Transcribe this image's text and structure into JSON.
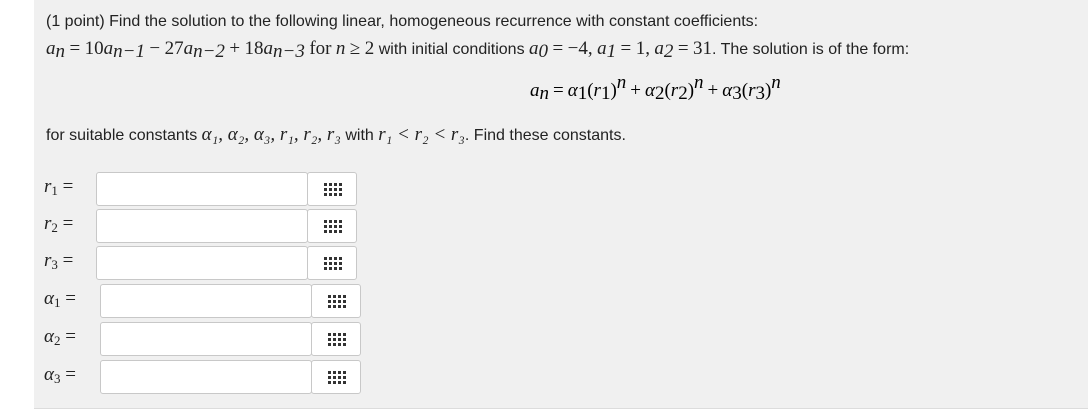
{
  "problem": {
    "intro": "(1 point) Find the solution to the following linear, homogeneous recurrence with constant coefficients:",
    "recurrence": {
      "lhs": "a",
      "lhs_sub": "n",
      "eq": "=",
      "coef1": "10",
      "term1": "a",
      "term1_sub": "n−1",
      "op1": "−",
      "coef2": "27",
      "term2": "a",
      "term2_sub": "n−2",
      "op2": "+",
      "coef3": "18",
      "term3": "a",
      "term3_sub": "n−3",
      "for_text": "for",
      "n_var": "n",
      "geq": "≥",
      "n_start": "2",
      "initial_text": "with initial conditions",
      "a0_sub": "0",
      "a0_val": "−4,",
      "a1_sub": "1",
      "a1_val": "1,",
      "a2_sub": "2",
      "a2_val": "31",
      "form_text": ". The solution is of the form:"
    },
    "solution_form": {
      "lhs": "a",
      "lhs_sub": "n",
      "eq": "=",
      "alpha": "α",
      "r": "r",
      "exp": "n",
      "plus": "+"
    },
    "suitable_prefix": "for suitable constants",
    "suitable_list": "α₁, α₂, α₃, r₁, r₂, r₃",
    "with_text": "with",
    "ordering": "r₁ < r₂ < r₃",
    "find_text": ". Find these constants."
  },
  "answers": [
    {
      "symbol": "r",
      "sub": "1",
      "eq": "=",
      "value": ""
    },
    {
      "symbol": "r",
      "sub": "2",
      "eq": "=",
      "value": ""
    },
    {
      "symbol": "r",
      "sub": "3",
      "eq": "=",
      "value": ""
    },
    {
      "symbol": "α",
      "sub": "1",
      "eq": "=",
      "value": ""
    },
    {
      "symbol": "α",
      "sub": "2",
      "eq": "=",
      "value": ""
    },
    {
      "symbol": "α",
      "sub": "3",
      "eq": "=",
      "value": ""
    }
  ],
  "icons": {
    "equation_editor": "grid-icon"
  },
  "colors": {
    "panel_bg": "#f0f0f0",
    "input_border": "#c8c8c8",
    "text": "#222222"
  }
}
